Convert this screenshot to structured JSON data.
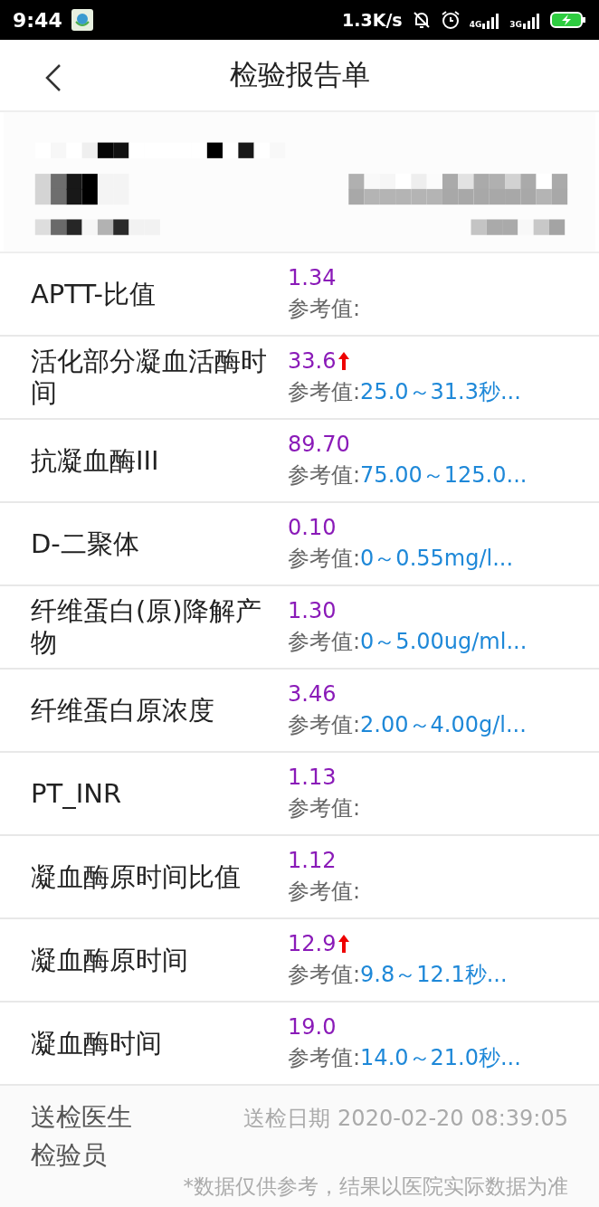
{
  "status_bar": {
    "time": "9:44",
    "speed": "1.3K/s",
    "networks": [
      "4G",
      "3G"
    ]
  },
  "nav": {
    "title": "检验报告单"
  },
  "results": [
    {
      "name": "APTT-比值",
      "value": "1.34",
      "high": false,
      "ref_label": "参考值:"
    },
    {
      "name": "活化部分凝血活酶时间",
      "value": "33.6",
      "high": true,
      "ref_label": "参考值:",
      "ref": "25.0～31.3秒..."
    },
    {
      "name": "抗凝血酶III",
      "value": "89.70",
      "high": false,
      "ref_label": "参考值:",
      "ref": "75.00～125.0..."
    },
    {
      "name": "D-二聚体",
      "value": "0.10",
      "high": false,
      "ref_label": "参考值:",
      "ref": "0～0.55mg/l..."
    },
    {
      "name": "纤维蛋白(原)降解产物",
      "value": "1.30",
      "high": false,
      "ref_label": "参考值:",
      "ref": "0～5.00ug/ml..."
    },
    {
      "name": "纤维蛋白原浓度",
      "value": "3.46",
      "high": false,
      "ref_label": "参考值:",
      "ref": "2.00～4.00g/l..."
    },
    {
      "name": "PT_INR",
      "value": "1.13",
      "high": false,
      "ref_label": "参考值:"
    },
    {
      "name": "凝血酶原时间比值",
      "value": "1.12",
      "high": false,
      "ref_label": "参考值:"
    },
    {
      "name": "凝血酶原时间",
      "value": "12.9",
      "high": true,
      "ref_label": "参考值:",
      "ref": "9.8～12.1秒..."
    },
    {
      "name": "凝血酶时间",
      "value": "19.0",
      "high": false,
      "ref_label": "参考值:",
      "ref": "14.0～21.0秒..."
    }
  ],
  "footer": {
    "doctor": "送检医生",
    "date": "送检日期 2020-02-20 08:39:05",
    "examiner": "检验员",
    "note": "*数据仅供参考，结果以医院实际数据为准"
  }
}
